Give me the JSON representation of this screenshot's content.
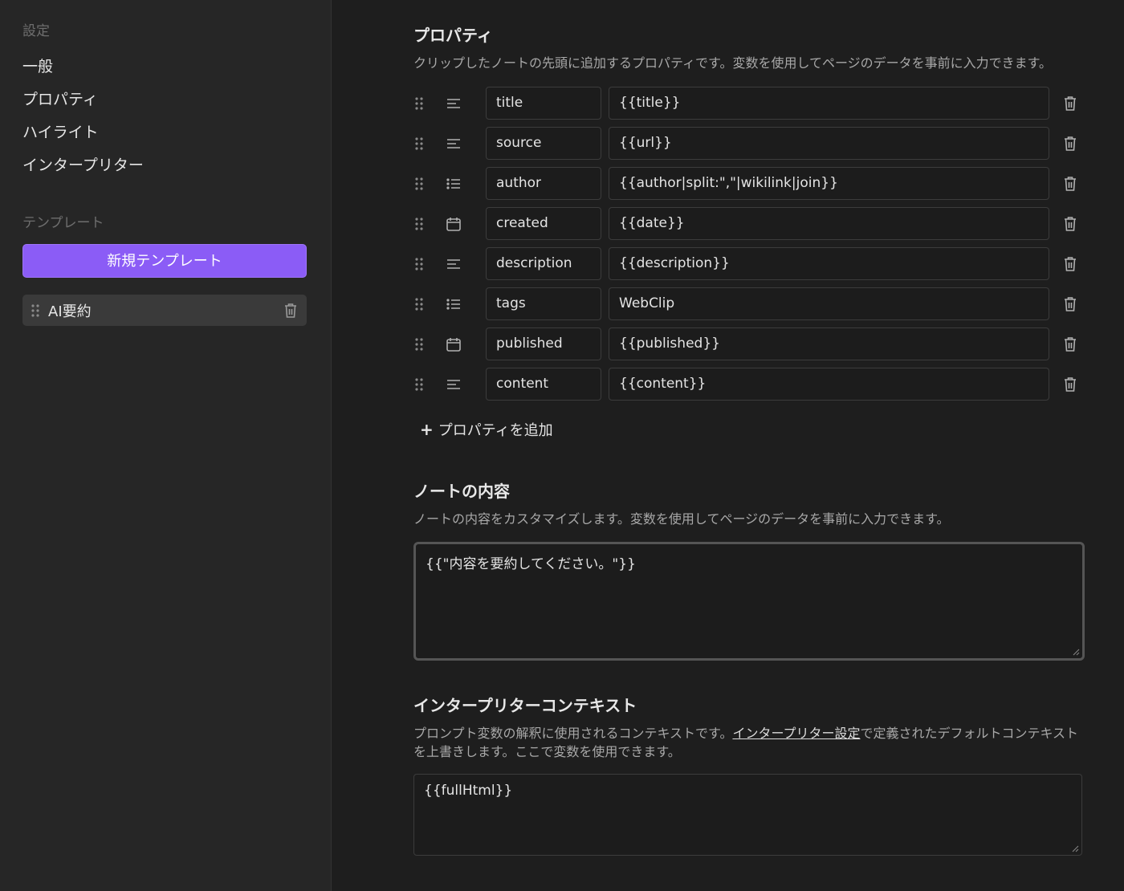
{
  "sidebar": {
    "settings_heading": "設定",
    "nav": [
      "一般",
      "プロパティ",
      "ハイライト",
      "インタープリター"
    ],
    "templates_heading": "テンプレート",
    "new_template_button": "新規テンプレート",
    "templates": [
      "AI要約"
    ]
  },
  "properties": {
    "title": "プロパティ",
    "description": "クリップしたノートの先頭に追加するプロパティです。変数を使用してページのデータを事前に入力できます。",
    "items": [
      {
        "name": "title",
        "value": "{{title}}",
        "type_icon": "text-icon"
      },
      {
        "name": "source",
        "value": "{{url}}",
        "type_icon": "text-icon"
      },
      {
        "name": "author",
        "value": "{{author|split:\",\"|wikilink|join}}",
        "type_icon": "list-icon"
      },
      {
        "name": "created",
        "value": "{{date}}",
        "type_icon": "calendar-icon"
      },
      {
        "name": "description",
        "value": "{{description}}",
        "type_icon": "text-icon"
      },
      {
        "name": "tags",
        "value": "WebClip",
        "type_icon": "list-icon"
      },
      {
        "name": "published",
        "value": "{{published}}",
        "type_icon": "calendar-icon"
      },
      {
        "name": "content",
        "value": "{{content}}",
        "type_icon": "text-icon"
      }
    ],
    "add_label": "プロパティを追加"
  },
  "note_content": {
    "title": "ノートの内容",
    "description": "ノートの内容をカスタマイズします。変数を使用してページのデータを事前に入力できます。",
    "value": "{{\"内容を要約してください。\"}}"
  },
  "interpreter_context": {
    "title": "インタープリターコンテキスト",
    "description_before": "プロンプト変数の解釈に使用されるコンテキストです。",
    "description_link": "インタープリター設定",
    "description_after": "で定義されたデフォルトコンテキストを上書きします。ここで変数を使用できます。",
    "value": "{{fullHtml}}"
  },
  "colors": {
    "accent": "#8b5cf6",
    "background": "#1e1e1e",
    "sidebar": "#262626"
  }
}
